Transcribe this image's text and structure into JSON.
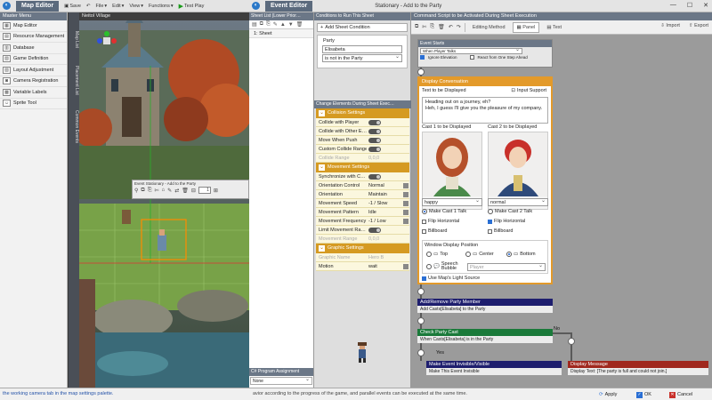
{
  "map_editor": {
    "tab": "Map Editor",
    "toolbar": {
      "save": "Save",
      "undo": "",
      "file": "File",
      "edit": "Edit",
      "view": "View",
      "functions": "Functions",
      "test_play": "Test Play"
    },
    "master_menu": {
      "header": "Master Menu",
      "items": [
        {
          "label": "Map Editor",
          "icon": "map-icon"
        },
        {
          "label": "Resource Management",
          "icon": "resource-icon"
        },
        {
          "label": "Database",
          "icon": "database-icon"
        },
        {
          "label": "Game Definition",
          "icon": "definition-icon"
        },
        {
          "label": "Layout Adjustment",
          "icon": "layout-icon"
        },
        {
          "label": "Camera Registration",
          "icon": "camera-icon"
        },
        {
          "label": "Variable Labels",
          "icon": "variable-icon"
        },
        {
          "label": "Sprite Tool",
          "icon": "sprite-icon"
        }
      ]
    },
    "side_tabs": [
      "Map List",
      "Placement List",
      "Common Events"
    ],
    "scene_title": "Neitol Village",
    "mini_event_title": "Event Stationary - Add to the Party",
    "mini_event_page": "1",
    "status_text": "the working camera tab in the map settings palette."
  },
  "event_editor": {
    "tab": "Event Editor",
    "title": "Stationary - Add to the Party",
    "sheet_list": {
      "header": "Sheet List (Lower Prior…",
      "items": [
        "1: Sheet"
      ]
    },
    "csharp": {
      "header": "C# Program Assignment",
      "value": "None"
    },
    "conditions": {
      "header": "Conditions to Run This Sheet",
      "add_label": "Add Sheet Condition",
      "label": "Party",
      "value": "Elisabeta",
      "operator": "is not in the Party"
    },
    "change_elements": {
      "header": "Change Elements During Sheet Exec…",
      "sections": [
        {
          "title": "Collision Settings",
          "rows": [
            {
              "label": "Collide with Player",
              "type": "toggle",
              "value": "",
              "disabled": false
            },
            {
              "label": "Collide with Other E…",
              "type": "toggle",
              "value": "",
              "disabled": false
            },
            {
              "label": "Move When Push",
              "type": "toggle",
              "value": "",
              "disabled": false
            },
            {
              "label": "Custom Collide Range",
              "type": "toggle",
              "value": "",
              "disabled": false
            },
            {
              "label": "Collide Range",
              "type": "text",
              "value": "0,0,0",
              "disabled": true
            }
          ]
        },
        {
          "title": "Movement Settings",
          "rows": [
            {
              "label": "Synchronize with C…",
              "type": "toggle",
              "value": "",
              "disabled": false
            },
            {
              "label": "Orientation Control",
              "type": "select",
              "value": "Normal",
              "disabled": false
            },
            {
              "label": "Orientation",
              "type": "select",
              "value": "Maintain",
              "disabled": false
            },
            {
              "label": "Movement Speed",
              "type": "select",
              "value": "-1 / Slow",
              "disabled": false
            },
            {
              "label": "Movement Pattern",
              "type": "select",
              "value": "Idle",
              "disabled": false
            },
            {
              "label": "Movement Frequency",
              "type": "select",
              "value": "-1 / Low",
              "disabled": false
            },
            {
              "label": "Limit Movement Ra…",
              "type": "toggle",
              "value": "",
              "disabled": false
            },
            {
              "label": "Movement Range",
              "type": "text",
              "value": "0,0,0",
              "disabled": true
            }
          ]
        },
        {
          "title": "Graphic Settings",
          "rows": [
            {
              "label": "Graphic Name",
              "type": "text",
              "value": "Hero B",
              "disabled": true
            },
            {
              "label": "Motion",
              "type": "select",
              "value": "wait",
              "disabled": false
            }
          ]
        }
      ]
    },
    "command": {
      "header": "Command Script to be Activated During Sheet Execution",
      "tabs": [
        "Editing Method",
        "Panel",
        "Text"
      ],
      "active_tab": "Panel",
      "import": "Import",
      "export": "Export",
      "event_starts": {
        "title": "Event Starts",
        "trigger": "When Player Talks",
        "ignore_elevation": "Ignore Elevation",
        "react_from_step": "React from One Step Ahead"
      },
      "display_conversation": {
        "title": "Display Conversation",
        "text_label": "Text to be Displayed",
        "input_support": "Input Support",
        "text": "Heading out on a journey, eh?\nHeh, I guess I'll give you the pleasure of my company.",
        "cast1_label": "Cast 1 to be Displayed",
        "cast2_label": "Cast 2 to be Displayed",
        "cast1_expression": "happy",
        "cast2_expression": "normal",
        "make_cast1_talk": "Make Cast 1 Talk",
        "make_cast2_talk": "Make Cast 2 Talk",
        "flip_h": "Flip Horizontal",
        "billboard": "Billboard",
        "window_position": "Window Display Position",
        "pos_top": "Top",
        "pos_center": "Center",
        "pos_bottom": "Bottom",
        "speech_bubble": "Speech Bubble",
        "bubble_target": "Player",
        "use_light": "Use Map's Light Source"
      },
      "add_remove": {
        "title": "Add/Remove Party Member",
        "body": "Add Casts[Elisabeta] to the Party"
      },
      "check_party": {
        "title": "Check Party Cast",
        "body": "When Casts[Elisabeta] is in the Party",
        "no_label": "No",
        "yes_label": "Yes"
      },
      "invisible": {
        "title": "Make Event Invisible/Visible",
        "body": "Make This Event Invisible"
      },
      "display_message": {
        "title": "Display Message",
        "body": "Display Text: [The party is full and could not join.]"
      }
    },
    "status_text": "avior according to the progress of the game, and parallel events can be executed at the same time.",
    "buttons": {
      "apply": "Apply",
      "ok": "OK",
      "cancel": "Cancel"
    }
  },
  "colors": {
    "section": "#d59a22",
    "header": "#6b7787",
    "conversation": "#e39a2a",
    "add_remove": "#1e1e6e",
    "check_party": "#1a7a3a",
    "invisible": "#1e1e6e",
    "message": "#a0281e"
  }
}
